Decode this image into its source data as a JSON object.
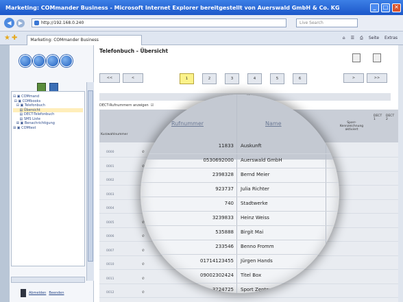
{
  "window": {
    "title": "Marketing: COMmander Business - Microsoft Internet Explorer bereitgestellt von Auerswald GmbH & Co. KG"
  },
  "browser": {
    "address": "http://192.168.0.240",
    "search_placeholder": "Live Search",
    "tab_label": "Marketing: COMmander Business",
    "commands": {
      "page": "Seite",
      "extras": "Extras"
    }
  },
  "sidebar": {
    "tree": [
      "COMmand",
      "COMbooks",
      "Telefonbuch",
      "Übersicht",
      "DECT-Telefonbuch",
      "SMS Liste",
      "Benachrichtigung",
      "COMtest"
    ],
    "logout": [
      "Abmelden",
      "Beenden"
    ]
  },
  "page": {
    "title": "Telefonbuch - Übersicht",
    "dect_label": "DECT-Rufnummern anzeigen",
    "range": "20001",
    "pager": {
      "first": "<<",
      "prev": "<",
      "next": ">",
      "last": ">>",
      "pages": [
        "1",
        "2",
        "3",
        "4",
        "5",
        "6"
      ]
    },
    "headers": {
      "kurz": "Kurzwahlnummer",
      "rufnummer": "Rufnummer",
      "name": "Name",
      "sperr": "Sperr-Kennzeichnung aktiviert",
      "dect1": "DECT 1",
      "dect2": "DECT 2"
    },
    "rows": [
      {
        "kurz": "0000",
        "nr": "11833",
        "name": "Auskunft"
      },
      {
        "kurz": "0001",
        "nr": "0530692000",
        "name": "Auerswald GmbH"
      },
      {
        "kurz": "0002",
        "nr": "2398328",
        "name": "Bernd Meier"
      },
      {
        "kurz": "0003",
        "nr": "923737",
        "name": "Julia Richter"
      },
      {
        "kurz": "0004",
        "nr": "740",
        "name": "Stadtwerke"
      },
      {
        "kurz": "0005",
        "nr": "3239833",
        "name": "Heinz Weiss"
      },
      {
        "kurz": "0006",
        "nr": "535888",
        "name": "Birgit Mai"
      },
      {
        "kurz": "0007",
        "nr": "233546",
        "name": "Benno Fromm"
      },
      {
        "kurz": "0010",
        "nr": "01714123455",
        "name": "Jürgen Hands"
      },
      {
        "kurz": "0011",
        "nr": "09002302424",
        "name": "Titel Box"
      },
      {
        "kurz": "0012",
        "nr": "3224725",
        "name": "Sport Zentrum"
      }
    ]
  }
}
